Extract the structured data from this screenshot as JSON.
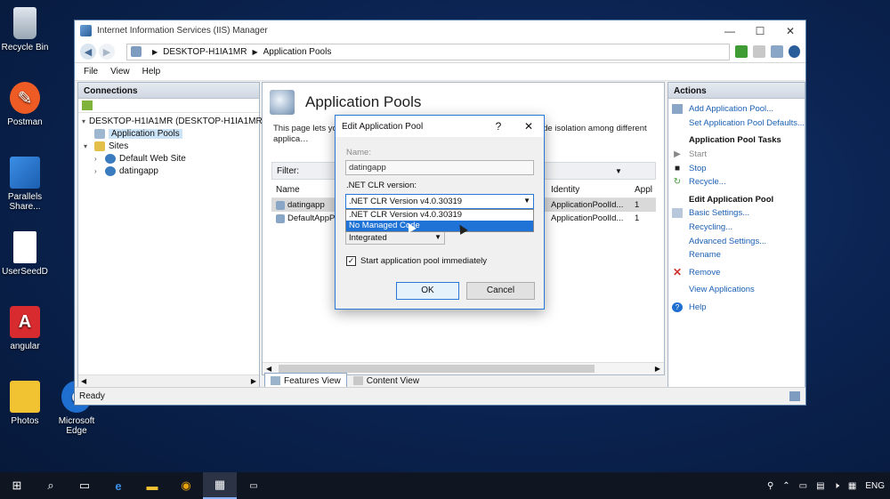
{
  "desktop": {
    "icons": [
      "Recycle Bin",
      "Postman",
      "Parallels Share...",
      "UserSeedD",
      "angular",
      "Photos",
      "Microsoft Edge"
    ]
  },
  "window": {
    "title": "Internet Information Services (IIS) Manager",
    "breadcrumb": [
      "DESKTOP-H1IA1MR",
      "Application Pools"
    ]
  },
  "menu": [
    "File",
    "View",
    "Help"
  ],
  "connections": {
    "header": "Connections",
    "tree": {
      "server": "DESKTOP-H1IA1MR (DESKTOP-H1IA1MR\\",
      "app_pools": "Application Pools",
      "sites": "Sites",
      "site1": "Default Web Site",
      "site2": "datingapp"
    }
  },
  "center": {
    "title": "Application Pools",
    "desc": "This page lets yo… server. Application pools are associated with… provide isolation among different applica…",
    "filter_label": "Filter:",
    "grouping": "ouping",
    "columns": {
      "name": "Name",
      "identity": "Identity",
      "appl": "Appl"
    },
    "rows": [
      {
        "name": "datingapp",
        "identity": "ApplicationPoolId...",
        "appl": "1"
      },
      {
        "name": "DefaultAppP...",
        "identity": "ApplicationPoolId...",
        "appl": "1"
      }
    ]
  },
  "view_tabs": {
    "features": "Features View",
    "content": "Content View"
  },
  "actions": {
    "header": "Actions",
    "add_pool": "Add Application Pool...",
    "set_defaults": "Set Application Pool Defaults...",
    "tasks_title": "Application Pool Tasks",
    "start": "Start",
    "stop": "Stop",
    "recycle": "Recycle...",
    "edit_title": "Edit Application Pool",
    "basic": "Basic Settings...",
    "recycling": "Recycling...",
    "advanced": "Advanced Settings...",
    "rename": "Rename",
    "remove": "Remove",
    "view_apps": "View Applications",
    "help": "Help"
  },
  "status": "Ready",
  "dialog": {
    "title": "Edit Application Pool",
    "help_btn": "?",
    "name_label": "Name:",
    "name_value": "datingapp",
    "clr_label": ".NET CLR version:",
    "clr_selected": ".NET CLR Version v4.0.30319",
    "clr_options": [
      ".NET CLR Version v4.0.30319",
      "No Managed Code"
    ],
    "pipeline_value": "Integrated",
    "start_checkbox": "Start application pool immediately",
    "start_checked": true,
    "ok": "OK",
    "cancel": "Cancel"
  },
  "tray": {
    "lang": "ENG"
  }
}
